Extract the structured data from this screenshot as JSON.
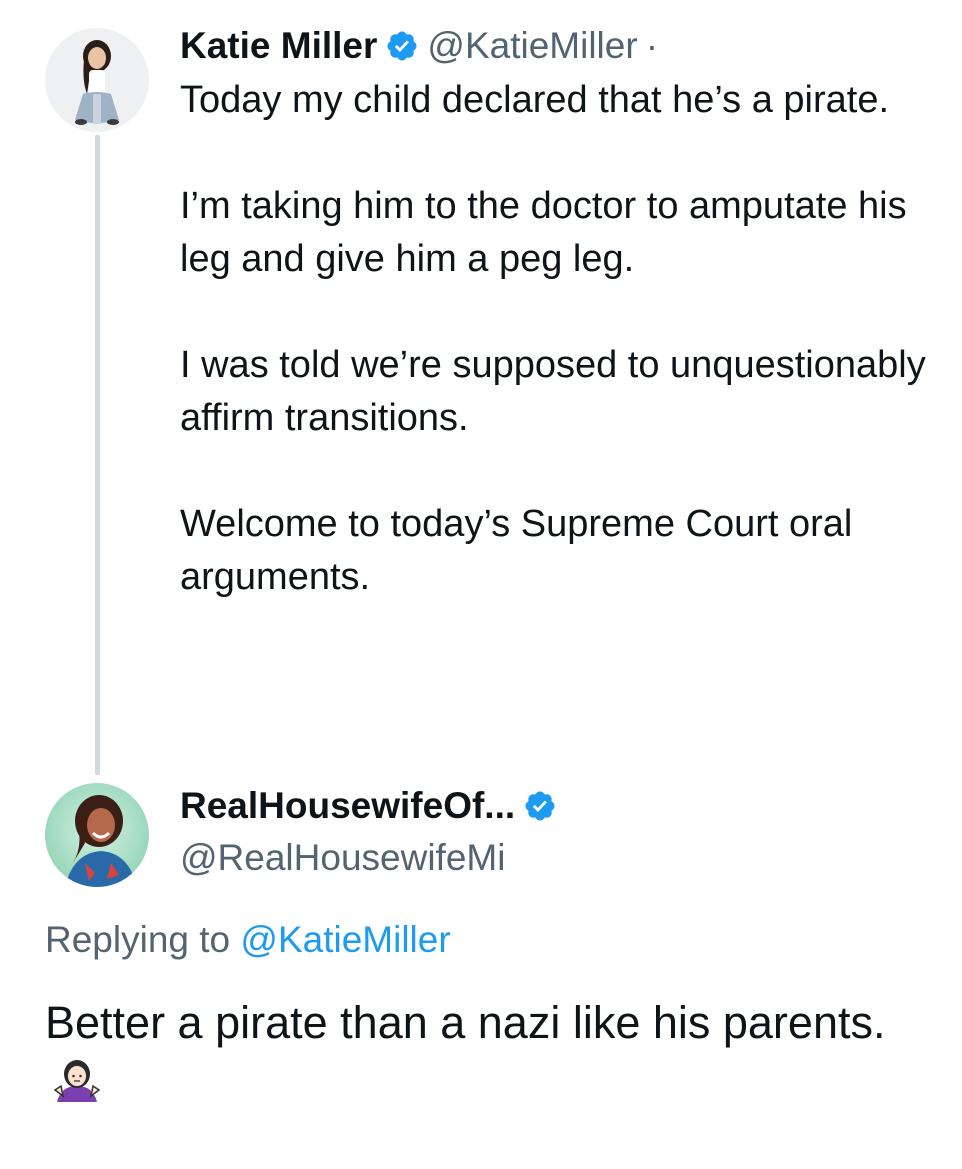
{
  "tweet": {
    "author_name": "Katie Miller",
    "author_handle": "@KatieMiller",
    "separator": "·",
    "avatar_icon": "profile-photo-woman",
    "verified_icon": "verified-badge-icon",
    "paragraphs": [
      "Today my child declared that he’s a pirate.",
      "I’m taking him to the doctor to amputate his leg and give him a peg leg.",
      "I was told we’re supposed to unquestionably affirm transitions.",
      "Welcome to today’s Supreme Court oral arguments."
    ]
  },
  "reply": {
    "author_name": "RealHousewifeOf...",
    "author_handle": "@RealHousewifeMi",
    "avatar_icon": "profile-photo-woman-smiling",
    "verified_icon": "verified-badge-icon",
    "replying_prefix": "Replying to",
    "replying_to": "@KatieMiller",
    "text": "Better a pirate than a nazi like his parents.",
    "emoji_icon": "woman-shrugging-emoji"
  },
  "colors": {
    "text_primary": "#0f1419",
    "text_secondary": "#536471",
    "link": "#1d9bf0",
    "verified": "#1d9bf0",
    "thread_line": "#cfd9de"
  }
}
